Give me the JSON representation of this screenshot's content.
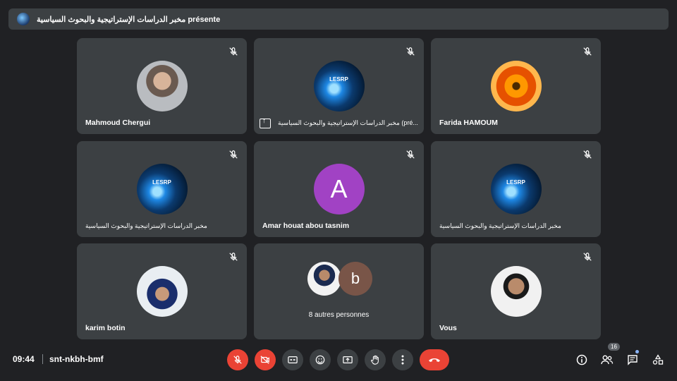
{
  "presentation_bar": {
    "title": "مخبر الدراسات الإستراتيجية والبحوث السياسية présente"
  },
  "tiles": [
    {
      "name": "Mahmoud Chergui"
    },
    {
      "name": "مخبر الدراسات الإستراتيجية والبحوث السياسية (pré..."
    },
    {
      "name": "Farida HAMOUM"
    },
    {
      "name": "مخبر الدراسات الإستراتيجية والبحوث السياسية"
    },
    {
      "name": "Amar houat abou tasnim",
      "avatar_letter": "A"
    },
    {
      "name": "مخبر الدراسات الإستراتيجية والبحوث السياسية"
    },
    {
      "name": "karim botin"
    },
    {
      "name": "8 autres personnes",
      "avatar_letter": "b"
    },
    {
      "name": "Vous"
    }
  ],
  "lesrp_label": "LESRP",
  "bottom": {
    "time": "09:44",
    "meeting_code": "snt-nkbh-bmf",
    "participants_count": "16"
  },
  "colors": {
    "background": "#202124",
    "tile": "#3c4043",
    "danger": "#ea4335",
    "avatar_a": "#a142c4"
  },
  "icons": [
    "mic-off-icon",
    "camera-off-icon",
    "captions-icon",
    "emoji-icon",
    "present-icon",
    "hand-icon",
    "more-icon",
    "hangup-icon",
    "info-icon",
    "people-icon",
    "chat-icon",
    "activities-icon"
  ]
}
